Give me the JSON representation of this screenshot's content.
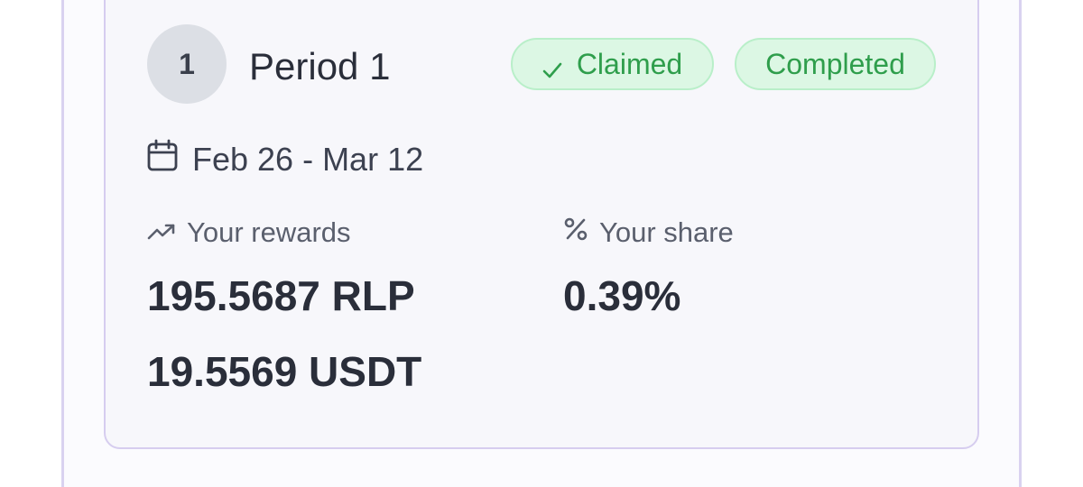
{
  "period": {
    "step_number": "1",
    "title": "Period 1",
    "badges": {
      "claimed": "Claimed",
      "completed": "Completed"
    },
    "date_range": "Feb 26 - Mar 12",
    "rewards": {
      "label": "Your rewards",
      "rlp": "195.5687 RLP",
      "usdt": "19.5569 USDT"
    },
    "share": {
      "label": "Your share",
      "value": "0.39%"
    }
  },
  "icons": {
    "claimed": "check-icon",
    "date": "calendar-icon",
    "rewards": "trending-up-icon",
    "share": "percent-icon"
  },
  "colors": {
    "badge_bg": "#dcf7e4",
    "badge_text": "#2f9e4c",
    "card_border": "#d6cdef",
    "step_circle": "#dcdfe5"
  }
}
